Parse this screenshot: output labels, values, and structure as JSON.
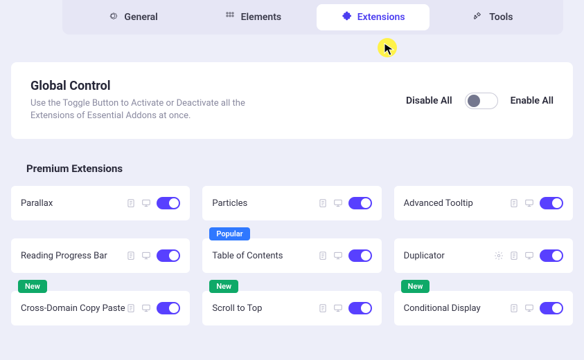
{
  "tabs": {
    "general": "General",
    "elements": "Elements",
    "extensions": "Extensions",
    "tools": "Tools"
  },
  "global": {
    "title": "Global Control",
    "desc": "Use the Toggle Button to Activate or Deactivate all the Extensions of Essential Addons at once.",
    "disable": "Disable All",
    "enable": "Enable All"
  },
  "section_title": "Premium Extensions",
  "badges": {
    "new": "New",
    "popular": "Popular"
  },
  "extensions": {
    "parallax": "Parallax",
    "particles": "Particles",
    "advanced_tooltip": "Advanced Tooltip",
    "reading_progress": "Reading Progress Bar",
    "toc": "Table of Contents",
    "duplicator": "Duplicator",
    "cross_domain": "Cross-Domain Copy Paste",
    "scroll_top": "Scroll to Top",
    "conditional": "Conditional Display"
  }
}
